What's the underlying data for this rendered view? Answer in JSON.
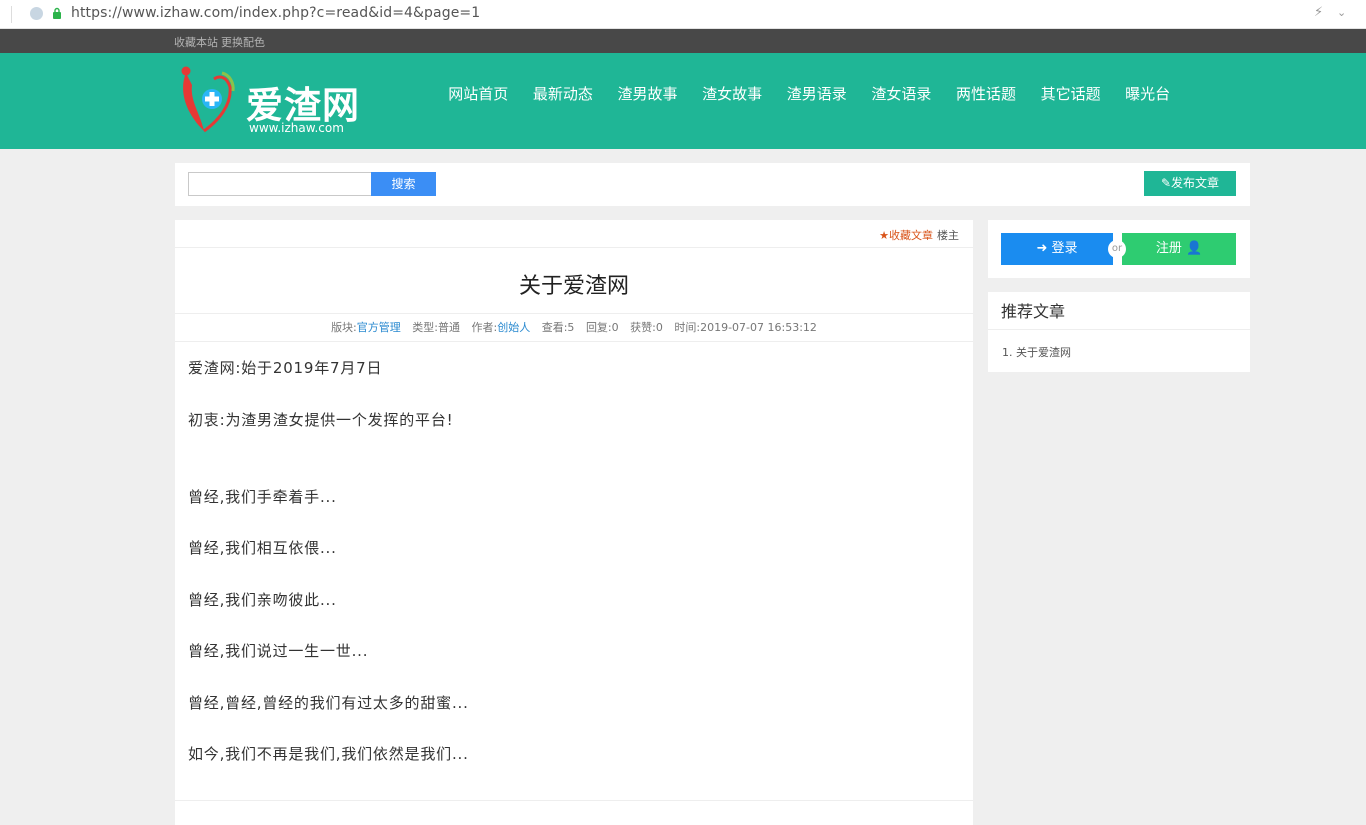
{
  "browser": {
    "url": "https://www.izhaw.com/index.php?c=read&id=4&page=1"
  },
  "topbar": {
    "favorite": "收藏本站",
    "change_color": "更换配色"
  },
  "logo": {
    "brand": "爱渣网",
    "site": "www.izhaw.com"
  },
  "nav": [
    "网站首页",
    "最新动态",
    "渣男故事",
    "渣女故事",
    "渣男语录",
    "渣女语录",
    "两性话题",
    "其它话题",
    "曝光台"
  ],
  "search": {
    "button": "搜索",
    "value": ""
  },
  "toolbar": {
    "post": "发布文章"
  },
  "article": {
    "collect": "收藏文章",
    "owner": "楼主",
    "title": "关于爱渣网",
    "meta": {
      "board_label": "版块:",
      "board": "官方管理",
      "type_label": "类型:",
      "type": "普通",
      "author_label": "作者:",
      "author": "创始人",
      "views": "查看:5",
      "replies": "回复:0",
      "likes": "获赞:0",
      "time": "时间:2019-07-07 16:53:12"
    },
    "paragraphs": [
      "爱渣网:始于2019年7月7日",
      "初衷:为渣男渣女提供一个发挥的平台!",
      "",
      "曾经,我们手牵着手...",
      "曾经,我们相互依偎...",
      "曾经,我们亲吻彼此...",
      "曾经,我们说过一生一世...",
      "曾经,曾经,曾经的我们有过太多的甜蜜...",
      "如今,我们不再是我们,我们依然是我们..."
    ]
  },
  "sidebar": {
    "login": "登录",
    "or": "or",
    "register": "注册",
    "recommend_title": "推荐文章",
    "recommend_items": [
      "1. 关于爱渣网"
    ]
  },
  "colors": {
    "brand": "#1fb696",
    "search": "#3b8ef5",
    "login": "#1a8cf0",
    "register": "#2ecc71",
    "collect": "#d9541a"
  }
}
